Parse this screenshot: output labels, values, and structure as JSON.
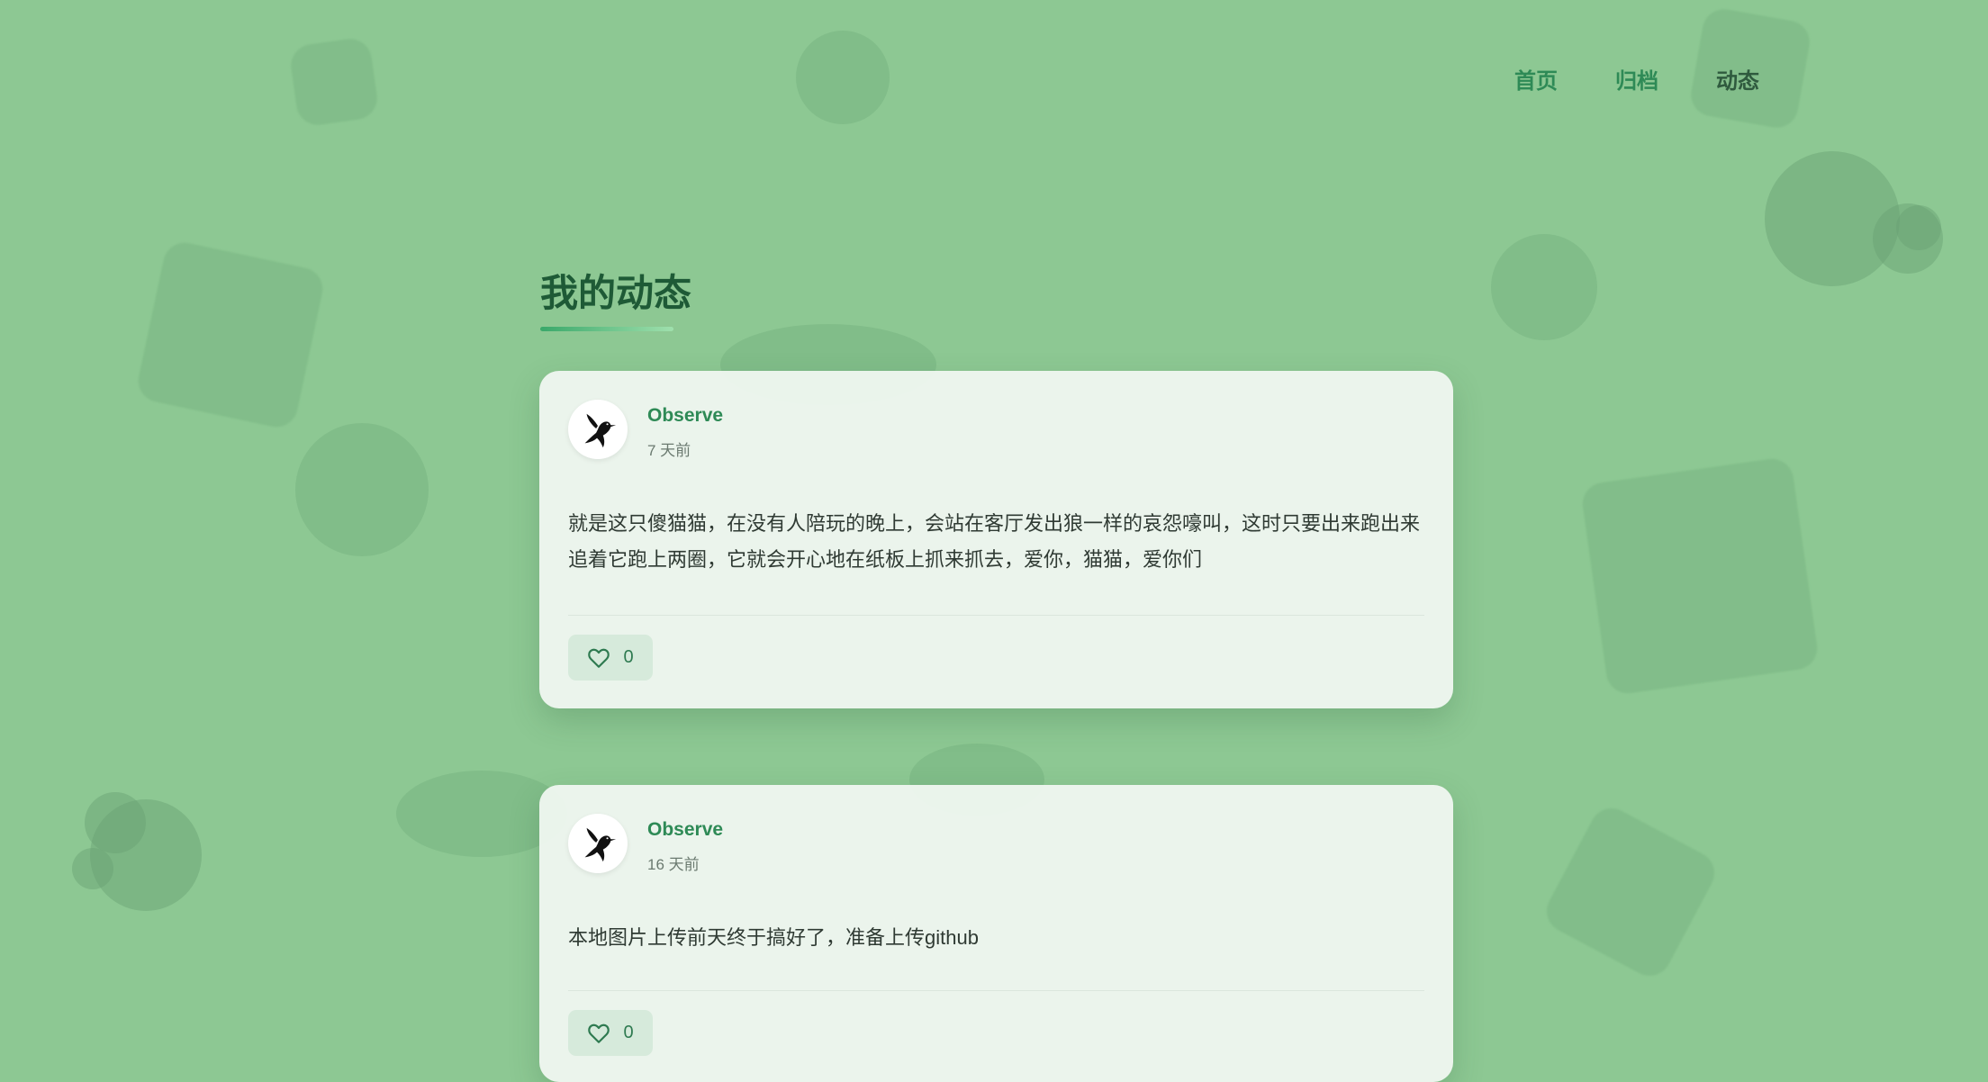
{
  "nav": {
    "items": [
      {
        "label": "首页"
      },
      {
        "label": "归档"
      },
      {
        "label": "动态"
      }
    ]
  },
  "page": {
    "title": "我的动态"
  },
  "posts": [
    {
      "author": "Observe",
      "time": "7 天前",
      "content": "就是这只傻猫猫，在没有人陪玩的晚上，会站在客厅发出狼一样的哀怨嚎叫，这时只要出来跑出来追着它跑上两圈，它就会开心地在纸板上抓来抓去，爱你，猫猫，爱你们",
      "likes": "0",
      "avatar_icon": "hummingbird-icon",
      "like_icon": "heart-icon"
    },
    {
      "author": "Observe",
      "time": "16 天前",
      "content": "本地图片上传前天终于搞好了，准备上传github",
      "likes": "0",
      "avatar_icon": "hummingbird-icon",
      "like_icon": "heart-icon"
    }
  ],
  "colors": {
    "background": "#8dc893",
    "accent": "#2e8a56",
    "title": "#1e5a36",
    "card": "#eef6ef"
  }
}
